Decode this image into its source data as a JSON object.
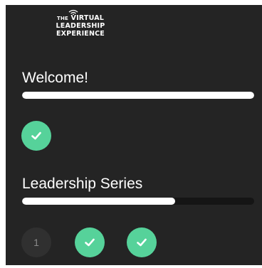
{
  "logo": {
    "line1_small": "THE",
    "line1": "VIRTUAL",
    "line2": "LEADERSHIP",
    "line3": "EXPERIENCE"
  },
  "sections": [
    {
      "title": "Welcome!",
      "progress": 1.0,
      "steps": [
        {
          "state": "completed",
          "icon": "check-icon"
        }
      ]
    },
    {
      "title": "Leadership Series",
      "progress": 0.66,
      "steps": [
        {
          "state": "pending",
          "label": "1"
        },
        {
          "state": "completed",
          "icon": "check-icon"
        },
        {
          "state": "completed",
          "icon": "check-icon"
        }
      ]
    }
  ],
  "colors": {
    "panel": "#242424",
    "track": "#151515",
    "progress_fill": "#ffffff",
    "completed": "#56d29a",
    "pending": "#303030"
  }
}
